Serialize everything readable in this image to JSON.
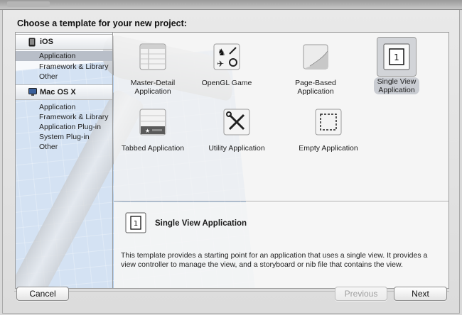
{
  "header": {
    "title": "Choose a template for your new project:"
  },
  "sidebar": {
    "sections": [
      {
        "title": "iOS",
        "icon": "iphone-icon",
        "items": [
          "Application",
          "Framework & Library",
          "Other"
        ],
        "selected_index": 0
      },
      {
        "title": "Mac OS X",
        "icon": "mac-icon",
        "items": [
          "Application",
          "Framework & Library",
          "Application Plug-in",
          "System Plug-in",
          "Other"
        ]
      }
    ]
  },
  "templates": [
    {
      "label_line1": "Master-Detail",
      "label_line2": "Application",
      "icon": "master-detail-icon"
    },
    {
      "label_line1": "OpenGL Game",
      "label_line2": "",
      "icon": "opengl-game-icon"
    },
    {
      "label_line1": "Page-Based",
      "label_line2": "Application",
      "icon": "page-curl-icon"
    },
    {
      "label_line1": "Single View",
      "label_line2": "Application",
      "icon": "single-view-icon",
      "selected": true
    },
    {
      "label_line1": "Tabbed Application",
      "label_line2": "",
      "icon": "tab-bar-icon"
    },
    {
      "label_line1": "Utility Application",
      "label_line2": "",
      "icon": "utility-tools-icon"
    },
    {
      "label_line1": "Empty Application",
      "label_line2": "",
      "icon": "empty-dashed-icon"
    }
  ],
  "single_view_glyph": "1",
  "description": {
    "title": "Single View Application",
    "text": "This template provides a starting point for an application that uses a single view. It provides a view controller to manage the view, and a storyboard or nib file that contains the view."
  },
  "buttons": {
    "cancel": "Cancel",
    "previous": "Previous",
    "next": "Next"
  },
  "colors": {
    "selection": "#b8bec8",
    "blueprint": "#a9c8ea"
  }
}
